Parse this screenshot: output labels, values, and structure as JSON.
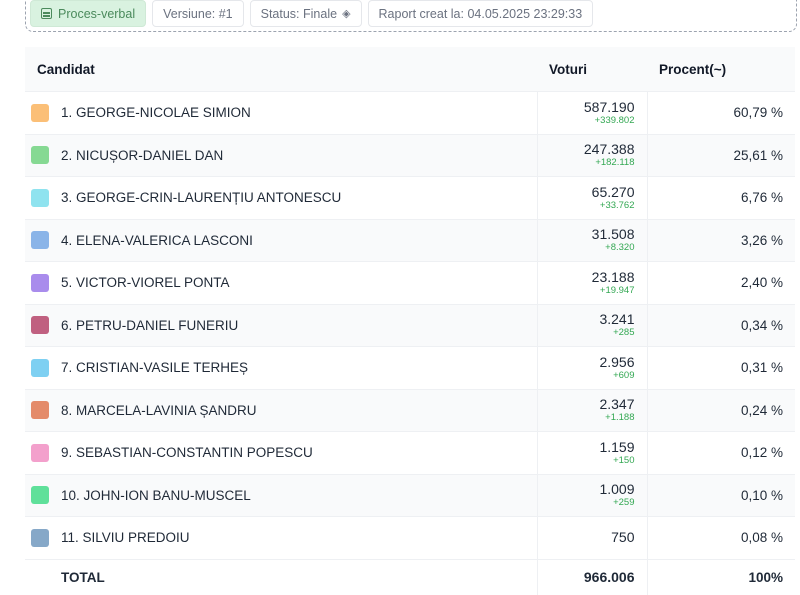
{
  "header": {
    "chips": {
      "proces_verbal": "Proces-verbal",
      "versiune": "Versiune: #1",
      "status": "Status: Finale",
      "raport": "Raport creat la: 04.05.2025 23:29:33"
    }
  },
  "table": {
    "columns": {
      "candidat": "Candidat",
      "voturi": "Voturi",
      "procent": "Procent(~)"
    },
    "rows": [
      {
        "name": "1. GEORGE-NICOLAE SIMION",
        "votes": "587.190",
        "delta": "+339.802",
        "percent": "60,79 %",
        "color": "#fbbf77"
      },
      {
        "name": "2. NICUȘOR-DANIEL DAN",
        "votes": "247.388",
        "delta": "+182.118",
        "percent": "25,61 %",
        "color": "#86d993"
      },
      {
        "name": "3. GEORGE-CRIN-LAURENȚIU ANTONESCU",
        "votes": "65.270",
        "delta": "+33.762",
        "percent": "6,76 %",
        "color": "#8fe3ef"
      },
      {
        "name": "4. ELENA-VALERICA LASCONI",
        "votes": "31.508",
        "delta": "+8.320",
        "percent": "3,26 %",
        "color": "#8ab4e8"
      },
      {
        "name": "5. VICTOR-VIOREL PONTA",
        "votes": "23.188",
        "delta": "+19.947",
        "percent": "2,40 %",
        "color": "#a98cec"
      },
      {
        "name": "6. PETRU-DANIEL FUNERIU",
        "votes": "3.241",
        "delta": "+285",
        "percent": "0,34 %",
        "color": "#c06080"
      },
      {
        "name": "7. CRISTIAN-VASILE TERHEȘ",
        "votes": "2.956",
        "delta": "+609",
        "percent": "0,31 %",
        "color": "#7ed0f2"
      },
      {
        "name": "8. MARCELA-LAVINIA ȘANDRU",
        "votes": "2.347",
        "delta": "+1.188",
        "percent": "0,24 %",
        "color": "#e48b6a"
      },
      {
        "name": "9. SEBASTIAN-CONSTANTIN POPESCU",
        "votes": "1.159",
        "delta": "+150",
        "percent": "0,12 %",
        "color": "#f3a0cc"
      },
      {
        "name": "10. JOHN-ION BANU-MUSCEL",
        "votes": "1.009",
        "delta": "+259",
        "percent": "0,10 %",
        "color": "#5fe09a"
      },
      {
        "name": "11. SILVIU PREDOIU",
        "votes": "750",
        "delta": "",
        "percent": "0,08 %",
        "color": "#86a8c8"
      }
    ],
    "total": {
      "label": "TOTAL",
      "votes": "966.006",
      "percent": "100%"
    }
  }
}
